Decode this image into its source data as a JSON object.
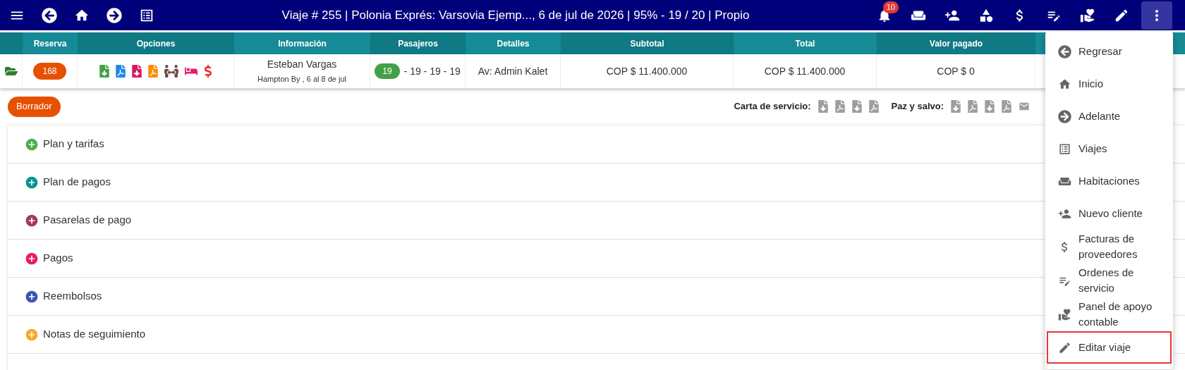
{
  "top_bar": {
    "title": "Viaje # 255 | Polonia Exprés: Varsovia Ejemp..., 6 de jul de 2026 | 95% - 19 / 20 | Propio",
    "notification_count": "10",
    "more_selected": true
  },
  "table": {
    "columns": [
      "Reserva",
      "Opciones",
      "Información",
      "Pasajeros",
      "Detalles",
      "Subtotal",
      "Total",
      "Valor pagado"
    ],
    "rows": [
      {
        "reserva": "168",
        "info_name": "Esteban Vargas",
        "info_sub": "Hampton By , 6 al 8 de jul",
        "pasajeros_badge": "19",
        "pasajeros_rest": "- 19 - 19 - 19",
        "detalles": "Av: Admin Kalet",
        "subtotal": "COP $ 11.400.000",
        "total": "COP $ 11.400.000",
        "valor_pagado": "COP $ 0"
      }
    ]
  },
  "status_button": "Borrador",
  "document_groups": [
    {
      "label": "Carta de servicio:"
    },
    {
      "label": "Paz y salvo:"
    }
  ],
  "sections": [
    {
      "label": "Plan y tarifas",
      "color": "#4caf50",
      "expanded": false
    },
    {
      "label": "Plan de pagos",
      "color": "#009688",
      "expanded": false
    },
    {
      "label": "Pasarelas de pago",
      "color": "#a8385a",
      "expanded": false
    },
    {
      "label": "Pagos",
      "color": "#e91e63",
      "expanded": false
    },
    {
      "label": "Reembolsos",
      "color": "#3f51b5",
      "expanded": false
    },
    {
      "label": "Notas de seguimiento",
      "color": "#f9a825",
      "expanded": false
    }
  ],
  "actions_menu": {
    "open": true,
    "items": [
      {
        "label": "Regresar",
        "highlighted": false
      },
      {
        "label": "Inicio",
        "highlighted": false
      },
      {
        "label": "Adelante",
        "highlighted": false
      },
      {
        "label": "Viajes",
        "highlighted": false
      },
      {
        "label": "Habitaciones",
        "highlighted": false
      },
      {
        "label": "Nuevo cliente",
        "highlighted": false
      },
      {
        "label": "Facturas de proveedores",
        "highlighted": false
      },
      {
        "label": "Ordenes de servicio",
        "highlighted": false
      },
      {
        "label": "Panel de apoyo contable",
        "highlighted": false
      },
      {
        "label": "Editar viaje",
        "highlighted": true
      }
    ]
  }
}
